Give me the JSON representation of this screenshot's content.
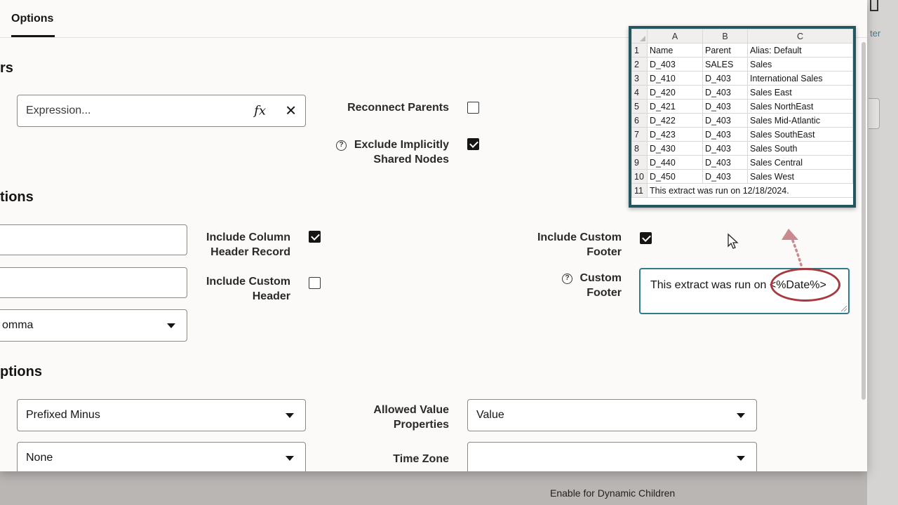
{
  "tabs": [
    {
      "label": "Options",
      "active": true
    }
  ],
  "sections": {
    "filters_partial": "rs",
    "output_partial": "tions",
    "format_partial": "ptions"
  },
  "filter": {
    "expression_placeholder": "Expression...",
    "fx_label": "fx",
    "clear_icon": "✕",
    "reconnect_parents_label": "Reconnect Parents",
    "reconnect_parents_checked": false,
    "exclude_shared_label_line1": "Exclude Implicitly",
    "exclude_shared_label_line2": "Shared Nodes",
    "exclude_shared_checked": true
  },
  "output": {
    "delimiter_value_partial": "omma",
    "include_column_header_line1": "Include Column",
    "include_column_header_line2": "Header Record",
    "include_column_header_checked": true,
    "include_custom_header_line1": "Include Custom",
    "include_custom_header_line2": "Header",
    "include_custom_header_checked": false,
    "include_custom_footer_line1": "Include Custom",
    "include_custom_footer_line2": "Footer",
    "include_custom_footer_checked": true,
    "custom_footer_line1": "Custom",
    "custom_footer_line2": "Footer",
    "custom_footer_value": "This extract was run on <%Date%>"
  },
  "format": {
    "negative_format_value": "Prefixed Minus",
    "second_select_value": "None",
    "allowed_value_properties_line1": "Allowed Value",
    "allowed_value_properties_line2": "Properties",
    "allowed_value_properties_value": "Value",
    "time_zone_label": "Time Zone",
    "time_zone_value": ""
  },
  "background": {
    "bottom_label": "Enable for Dynamic Children",
    "link_partial": "ter"
  },
  "spreadsheet": {
    "columns": [
      "A",
      "B",
      "C"
    ],
    "rows": [
      {
        "n": "1",
        "a": "Name",
        "b": "Parent",
        "c": "Alias: Default"
      },
      {
        "n": "2",
        "a": "D_403",
        "b": "SALES",
        "c": "Sales"
      },
      {
        "n": "3",
        "a": "D_410",
        "b": "D_403",
        "c": "International Sales"
      },
      {
        "n": "4",
        "a": "D_420",
        "b": "D_403",
        "c": "Sales East"
      },
      {
        "n": "5",
        "a": "D_421",
        "b": "D_403",
        "c": "Sales NorthEast"
      },
      {
        "n": "6",
        "a": "D_422",
        "b": "D_403",
        "c": "Sales Mid-Atlantic"
      },
      {
        "n": "7",
        "a": "D_423",
        "b": "D_403",
        "c": "Sales SouthEast"
      },
      {
        "n": "8",
        "a": "D_430",
        "b": "D_403",
        "c": "Sales South"
      },
      {
        "n": "9",
        "a": "D_440",
        "b": "D_403",
        "c": "Sales Central"
      },
      {
        "n": "10",
        "a": "D_450",
        "b": "D_403",
        "c": "Sales West"
      }
    ],
    "footer_row": {
      "n": "11",
      "text": "This extract was run on 12/18/2024."
    }
  },
  "colors": {
    "accent": "#2f7d8c",
    "callout_border": "#23565f",
    "annotation": "#a8393f"
  }
}
